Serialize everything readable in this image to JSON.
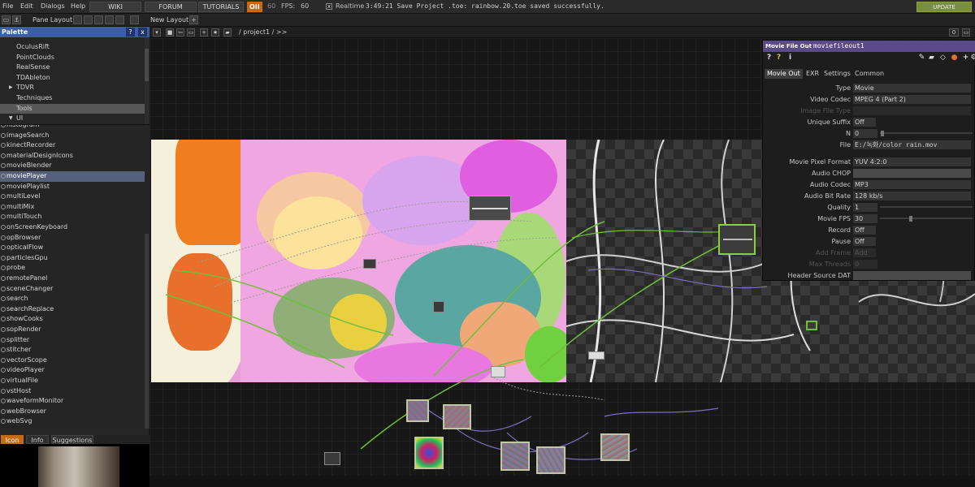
{
  "menu": {
    "items": [
      "File",
      "Edit",
      "Dialogs",
      "Help"
    ],
    "buttons": [
      "WIKI",
      "FORUM",
      "TUTORIALS"
    ],
    "oii_badge": "OII",
    "frame_value": "60",
    "fps_label": "FPS:",
    "fps_value": "60",
    "realtime_label": "Realtime",
    "status_message": "3:49:21 Save Project .toe: rainbow.20.toe saved successfully.",
    "update_label": "UPDATE"
  },
  "bar2": {
    "pane_layout": "Pane Layout",
    "new_layout": "New Layout",
    "add_icon": "+"
  },
  "palette": {
    "title": "Palette",
    "help_btn": "?",
    "close_btn": "x",
    "categories": [
      {
        "label": "OculusRift",
        "selected": false,
        "arrow": ""
      },
      {
        "label": "PointClouds",
        "selected": false,
        "arrow": ""
      },
      {
        "label": "RealSense",
        "selected": false,
        "arrow": ""
      },
      {
        "label": "TDAbleton",
        "selected": false,
        "arrow": ""
      },
      {
        "label": "TDVR",
        "selected": false,
        "arrow": "▶"
      },
      {
        "label": "Techniques",
        "selected": false,
        "arrow": ""
      },
      {
        "label": "Tools",
        "selected": true,
        "arrow": ""
      },
      {
        "label": "UI",
        "selected": false,
        "arrow": "▼"
      }
    ],
    "components": [
      "histogram",
      "imageSearch",
      "kinectRecorder",
      "materialDesignIcons",
      "movieBlender",
      "moviePlayer",
      "moviePlaylist",
      "multiLevel",
      "multiMix",
      "multiTouch",
      "onScreenKeyboard",
      "opBrowser",
      "opticalFlow",
      "particlesGpu",
      "probe",
      "remotePanel",
      "sceneChanger",
      "search",
      "searchReplace",
      "showCooks",
      "sopRender",
      "splitter",
      "stitcher",
      "vectorScope",
      "videoPlayer",
      "virtualFile",
      "vstHost",
      "waveformMonitor",
      "webBrowser",
      "webSvg"
    ],
    "selected_component": "moviePlayer",
    "tabs": [
      "Icon",
      "Info",
      "Suggestions"
    ],
    "active_tab": "Icon"
  },
  "network": {
    "path": "/ project1 / >>",
    "zoom_value": "0"
  },
  "param": {
    "op_type": "Movie File Out",
    "op_name": "moviefileout1",
    "tabs": [
      "Movie Out",
      "EXR",
      "Settings",
      "Common"
    ],
    "active_tab": "Movie Out",
    "rows": {
      "type": {
        "label": "Type",
        "value": "Movie"
      },
      "video_codec": {
        "label": "Video Codec",
        "value": "MPEG 4 (Part 2)"
      },
      "image_file_type": {
        "label": "Image File Type",
        "value": ""
      },
      "unique_suffix": {
        "label": "Unique Suffix",
        "value": "Off"
      },
      "n": {
        "label": "N",
        "value": "0"
      },
      "file": {
        "label": "File",
        "value": "E:/녹화/color rain.mov"
      },
      "pixel_format": {
        "label": "Movie Pixel Format",
        "value": "YUV 4:2:0"
      },
      "audio_chop": {
        "label": "Audio CHOP",
        "value": ""
      },
      "audio_codec": {
        "label": "Audio Codec",
        "value": "MP3"
      },
      "audio_bit_rate": {
        "label": "Audio Bit Rate",
        "value": "128 kb/s"
      },
      "quality": {
        "label": "Quality",
        "value": "1"
      },
      "movie_fps": {
        "label": "Movie FPS",
        "value": "30"
      },
      "record": {
        "label": "Record",
        "value": "Off"
      },
      "pause": {
        "label": "Pause",
        "value": "Off"
      },
      "add_frame": {
        "label": "Add Frame",
        "value": "Add"
      },
      "max_threads": {
        "label": "Max Threads",
        "value": "0"
      },
      "header_source_dat": {
        "label": "Header Source DAT",
        "value": ""
      }
    }
  },
  "colors": {
    "palette_header": "#3d5fa0",
    "param_header": "#5b4a8a",
    "accent_orange": "#c86a10",
    "update_green": "#7a8f3a"
  }
}
